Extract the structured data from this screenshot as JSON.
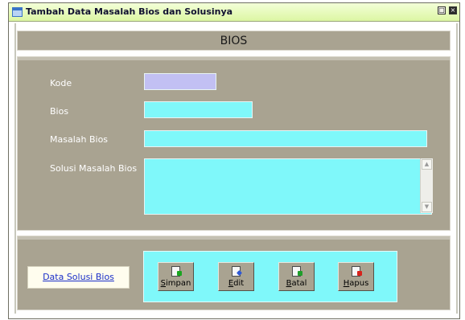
{
  "window": {
    "title": "Tambah Data Masalah Bios dan Solusinya"
  },
  "header": {
    "title": "BIOS"
  },
  "form": {
    "kode": {
      "label": "Kode",
      "value": ""
    },
    "bios": {
      "label": "Bios",
      "value": ""
    },
    "masalah": {
      "label": "Masalah Bios",
      "value": ""
    },
    "solusi": {
      "label": "Solusi Masalah Bios",
      "value": ""
    }
  },
  "actions": {
    "link_label": "Data Solusi Bios",
    "simpan": "Simpan",
    "edit": "Edit",
    "batal": "Batal",
    "hapus": "Hapus"
  },
  "icons": {
    "window": "form-window-icon",
    "restore": "restore-icon",
    "close": "close-icon",
    "simpan": "save-icon",
    "edit": "edit-icon",
    "batal": "cancel-icon",
    "hapus": "delete-icon"
  },
  "colors": {
    "panel": "#a9a391",
    "field": "#7ff8fa",
    "kode_field": "#c2c0f3",
    "title_bar": "#dcf6a3",
    "link": "#1b2fc8"
  }
}
